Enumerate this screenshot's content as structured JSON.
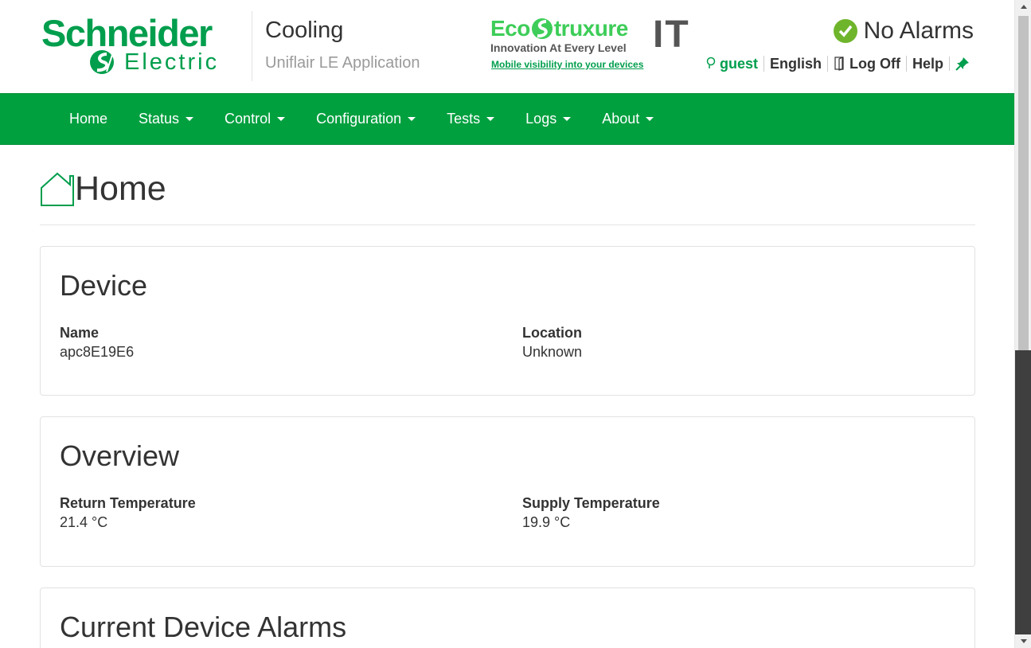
{
  "header": {
    "brand_line1": "Schneider",
    "brand_line2": "Electric",
    "app_title": "Cooling",
    "app_subtitle": "Uniflair LE Application",
    "eco_brand_a": "Eco",
    "eco_brand_b": "truxure",
    "eco_tagline": "Innovation At Every Level",
    "eco_it": "IT",
    "eco_link": "Mobile visibility into your devices",
    "alarm_status": "No Alarms",
    "user": "guest",
    "language": "English",
    "logoff": "Log Off",
    "help": "Help"
  },
  "nav": {
    "items": [
      {
        "label": "Home",
        "dropdown": false
      },
      {
        "label": "Status",
        "dropdown": true
      },
      {
        "label": "Control",
        "dropdown": true
      },
      {
        "label": "Configuration",
        "dropdown": true
      },
      {
        "label": "Tests",
        "dropdown": true
      },
      {
        "label": "Logs",
        "dropdown": true
      },
      {
        "label": "About",
        "dropdown": true
      }
    ]
  },
  "page": {
    "title": "Home"
  },
  "device": {
    "heading": "Device",
    "name_label": "Name",
    "name_value": "apc8E19E6",
    "location_label": "Location",
    "location_value": "Unknown"
  },
  "overview": {
    "heading": "Overview",
    "return_label": "Return Temperature",
    "return_value": "21.4 °C",
    "supply_label": "Supply Temperature",
    "supply_value": "19.9 °C"
  },
  "alarms": {
    "heading": "Current Device Alarms"
  },
  "colors": {
    "brand_green": "#009e4d",
    "nav_green": "#00a03f",
    "eco_green": "#3dcd58",
    "ok_green": "#6fb52c"
  },
  "icons": [
    "schneider-mark-icon",
    "check-circle-icon",
    "user-icon",
    "logoff-icon",
    "pin-icon",
    "home-icon",
    "caret-down-icon"
  ]
}
